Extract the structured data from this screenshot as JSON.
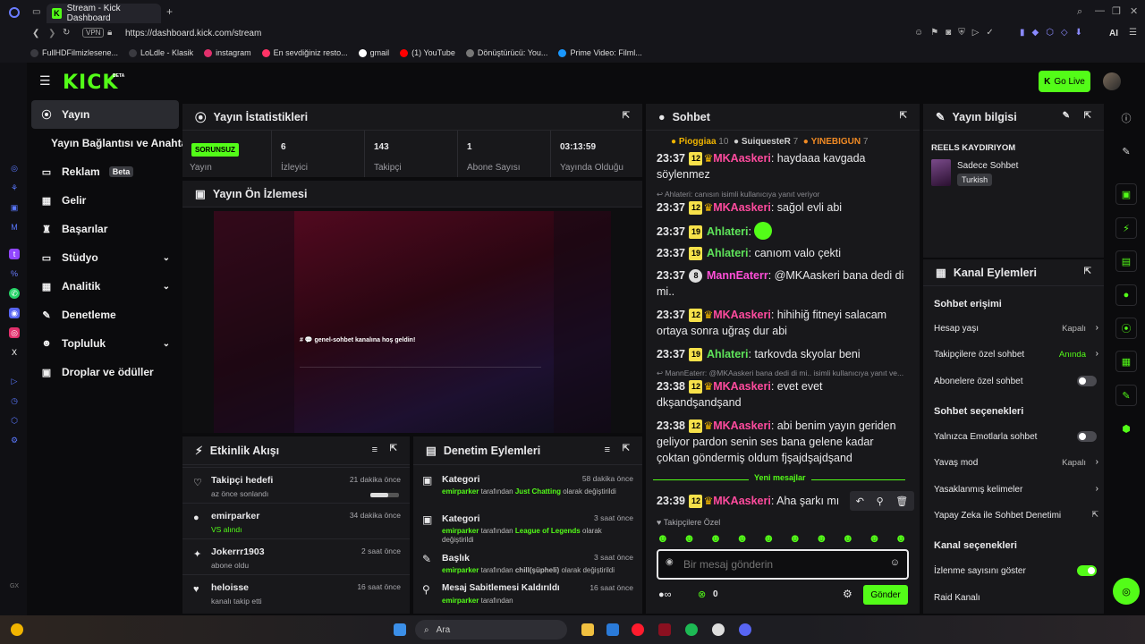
{
  "browser": {
    "tab_title": "Stream - Kick Dashboard",
    "url": "https://dashboard.kick.com/stream",
    "vpn": "VPN",
    "ai": "AI",
    "bookmarks": [
      {
        "label": "FullHDFilmizlesene...",
        "color": "#3a3a40"
      },
      {
        "label": "LoLdle - Klasik",
        "color": "#3a3a40"
      },
      {
        "label": "instagram",
        "color": "#e1306c"
      },
      {
        "label": "En sevdiğiniz resto...",
        "color": "#ff3366"
      },
      {
        "label": "gmail",
        "color": "#ffffff"
      },
      {
        "label": "(1) YouTube",
        "color": "#ff0000"
      },
      {
        "label": "Dönüştürücü: You...",
        "color": "#777777"
      },
      {
        "label": "Prime Video: Filml...",
        "color": "#1a98ff"
      }
    ]
  },
  "header": {
    "logo": "KICK",
    "beta": "BETA",
    "go_live": "Go Live"
  },
  "nav": {
    "items": [
      {
        "label": "Yayın",
        "icon": "((•))"
      },
      {
        "label": "Yayın Bağlantısı ve Anahtarı",
        "icon": ""
      },
      {
        "label": "Reklam",
        "icon": "▭",
        "badge": "Beta"
      },
      {
        "label": "Gelir",
        "icon": "▦"
      },
      {
        "label": "Başarılar",
        "icon": "🏆"
      },
      {
        "label": "Stüdyo",
        "icon": "▭"
      },
      {
        "label": "Analitik",
        "icon": "▦"
      },
      {
        "label": "Denetleme",
        "icon": "🔧"
      },
      {
        "label": "Topluluk",
        "icon": "👥"
      },
      {
        "label": "Droplar ve ödüller",
        "icon": "🎁"
      }
    ]
  },
  "stats": {
    "title": "Yayın İstatistikleri",
    "status_value": "SORUNSUZ",
    "status_label": "Yayın",
    "viewers_value": "6",
    "viewers_label": "İzleyici",
    "followers_value": "143",
    "followers_label": "Takipçi",
    "subs_value": "1",
    "subs_label": "Abone Sayısı",
    "uptime_value": "03:13:59",
    "uptime_label": "Yayında Olduğu"
  },
  "preview": {
    "title": "Yayın Ön İzlemesi",
    "welcome": "# 💬 genel-sohbet kanalına hoş geldin!"
  },
  "activity": {
    "title": "Etkinlik Akışı",
    "rows": [
      {
        "title": "Takipçi hedefi",
        "sub": "az önce sonlandı",
        "time": "21 dakika önce",
        "icon": "♡"
      },
      {
        "title": "emirparker",
        "sub": "VS alındı",
        "time": "34 dakika önce",
        "icon": "●"
      },
      {
        "title": "Jokerrr1903",
        "sub": "abone oldu",
        "time": "2 saat önce",
        "icon": "✦"
      },
      {
        "title": "heloisse",
        "sub": "kanalı takip etti",
        "time": "16 saat önce",
        "icon": "♥"
      }
    ]
  },
  "moderation": {
    "title": "Denetim Eylemleri",
    "by_word": "tarafından",
    "rows": [
      {
        "title": "Kategori",
        "time": "58 dakika önce",
        "user": "emirparker",
        "hl": "Just Chatting",
        "suffix": "olarak değiştirildi"
      },
      {
        "title": "Kategori",
        "time": "3 saat önce",
        "user": "emirparker",
        "hl": "League of Legends",
        "suffix": "olarak değiştirildi"
      },
      {
        "title": "Başlık",
        "time": "3 saat önce",
        "user": "emirparker",
        "hl": "chill(şüpheli)",
        "suffix": "olarak değiştirildi"
      },
      {
        "title": "Mesaj Sabitlemesi Kaldırıldı",
        "time": "16 saat önce",
        "user": "emirparker",
        "hl": "",
        "suffix": "tarafından"
      }
    ]
  },
  "chat": {
    "title": "Sohbet",
    "top_gifters": [
      {
        "name": "Pioggiaa",
        "count": "10",
        "color": "#f0b400"
      },
      {
        "name": "SuiquesteR",
        "count": "7",
        "color": "#cfcfcf"
      },
      {
        "name": "YINEBIGUN",
        "count": "7",
        "color": "#f08a24"
      }
    ],
    "messages": [
      {
        "time": "23:37",
        "lvl": "12",
        "user": "MKAaskeri",
        "text": ": haydaaa kavgada söylenmez"
      },
      {
        "reply": "Ahlateri: canısın isimli kullanıcıya yanıt veriyor"
      },
      {
        "time": "23:37",
        "lvl": "12",
        "user": "MKAaskeri",
        "text": ": sağol evli abi"
      },
      {
        "time": "23:37",
        "lvl": "19",
        "user": "Ahlateri",
        "text": ":"
      },
      {
        "time": "23:37",
        "lvl": "19",
        "user": "Ahlateri",
        "text": ": canıom valo çekti"
      },
      {
        "time": "23:37",
        "lvl": "8",
        "user": "MannEaterr",
        "text": ": @MKAaskeri bana dedi di mi.."
      },
      {
        "time": "23:37",
        "lvl": "12",
        "user": "MKAaskeri",
        "text": ": hihihiğ fitneyi salacam ortaya sonra uğraş dur abi"
      },
      {
        "time": "23:37",
        "lvl": "19",
        "user": "Ahlateri",
        "text": ": tarkovda skyolar beni"
      },
      {
        "reply": "MannEaterr: @MKAaskeri bana dedi di mi.. isimli kullanıcıya yanıt ve..."
      },
      {
        "time": "23:38",
        "lvl": "12",
        "user": "MKAaskeri",
        "text": ": evet evet dkşandşandşand"
      },
      {
        "time": "23:38",
        "lvl": "12",
        "user": "MKAaskeri",
        "text": ": abi benim yayın geriden geliyor pardon senin ses bana gelene kadar çoktan göndermiş oldum fjşajdşajdşand"
      },
      {
        "time": "23:39",
        "lvl": "12",
        "user": "MKAaskeri",
        "text": ": Aha şarkı mı"
      }
    ],
    "new_messages": "Yeni mesajlar",
    "followers_only": "Takipçilere Özel",
    "placeholder": "Bir mesaj gönderin",
    "points": "0",
    "send": "Gönder"
  },
  "stream_info": {
    "title": "Yayın bilgisi",
    "stream_title": "REELS KAYDIRIYOM",
    "category": "Sadece Sohbet",
    "tag": "Turkish"
  },
  "channel_actions": {
    "title": "Kanal Eylemleri",
    "chat_access": "Sohbet erişimi",
    "account_age": "Hesap yaşı",
    "account_age_val": "Kapalı",
    "followers_only": "Takipçilere özel sohbet",
    "followers_only_val": "Anında",
    "subs_only": "Abonelere özel sohbet",
    "chat_options": "Sohbet seçenekleri",
    "emote_only": "Yalnızca Emotlarla sohbet",
    "slow_mode": "Yavaş mod",
    "slow_mode_val": "Kapalı",
    "banned_words": "Yasaklanmış kelimeler",
    "ai_mod": "Yapay Zeka ile Sohbet Denetimi",
    "channel_options": "Kanal seçenekleri",
    "show_viewers": "İzlenme sayısını göster",
    "raid": "Raid Kanalı"
  },
  "taskbar": {
    "search": "Ara"
  }
}
